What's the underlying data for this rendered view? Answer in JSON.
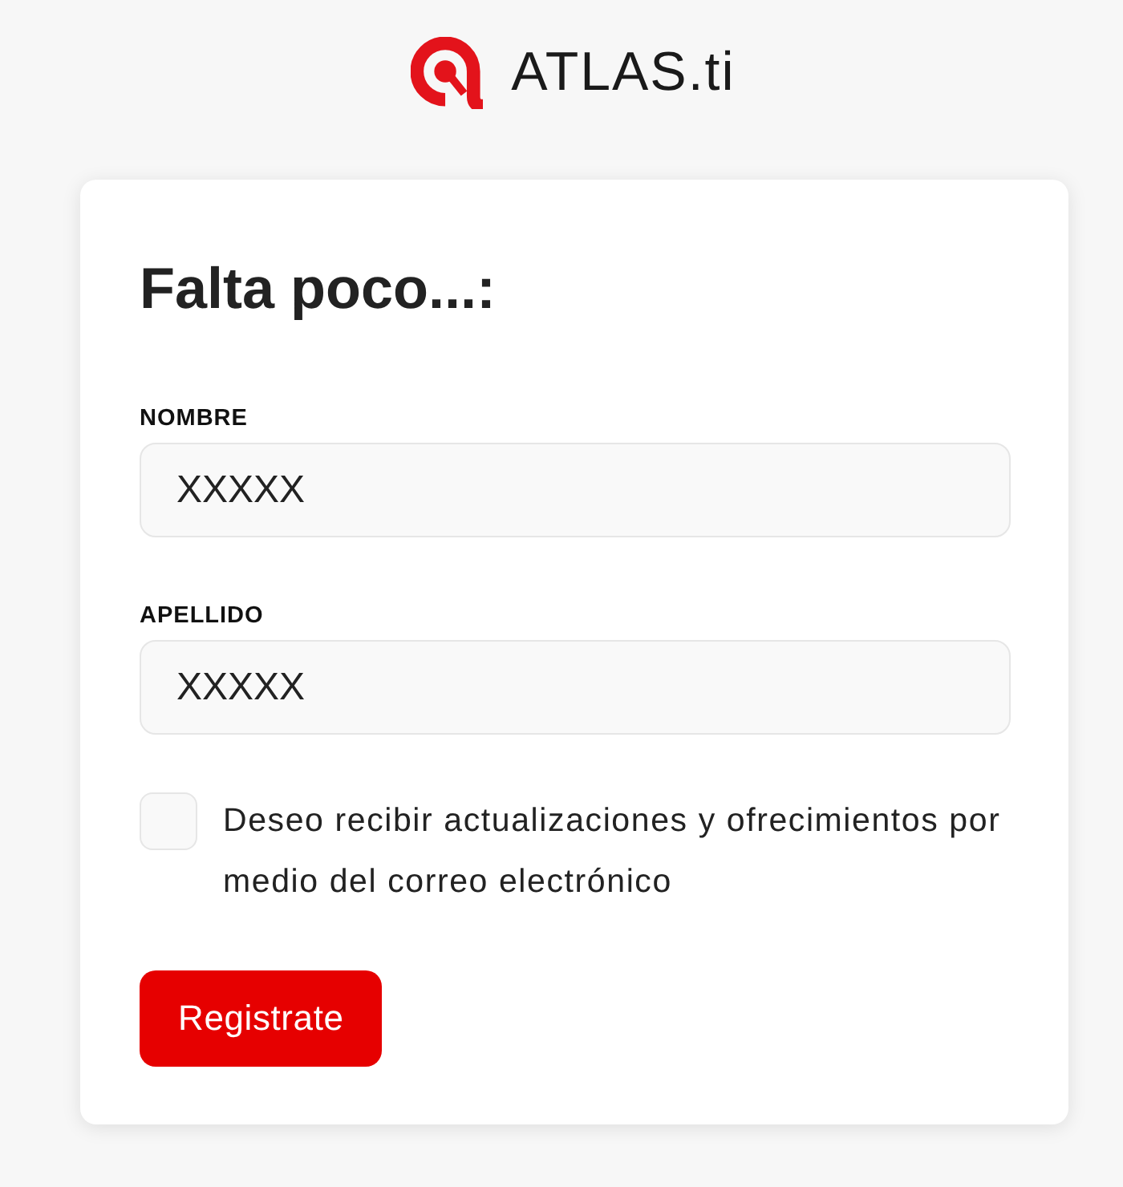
{
  "logo": {
    "text": "ATLAS.ti"
  },
  "form": {
    "title": "Falta poco...:",
    "fields": [
      {
        "label": "NOMBRE",
        "value": "XXXXX"
      },
      {
        "label": "APELLIDO",
        "value": "XXXXX"
      }
    ],
    "consent": {
      "label": "Deseo recibir actualizaciones y ofrecimientos por medio del correo electrónico",
      "checked": false
    },
    "submit": {
      "label": "Registrate"
    }
  }
}
